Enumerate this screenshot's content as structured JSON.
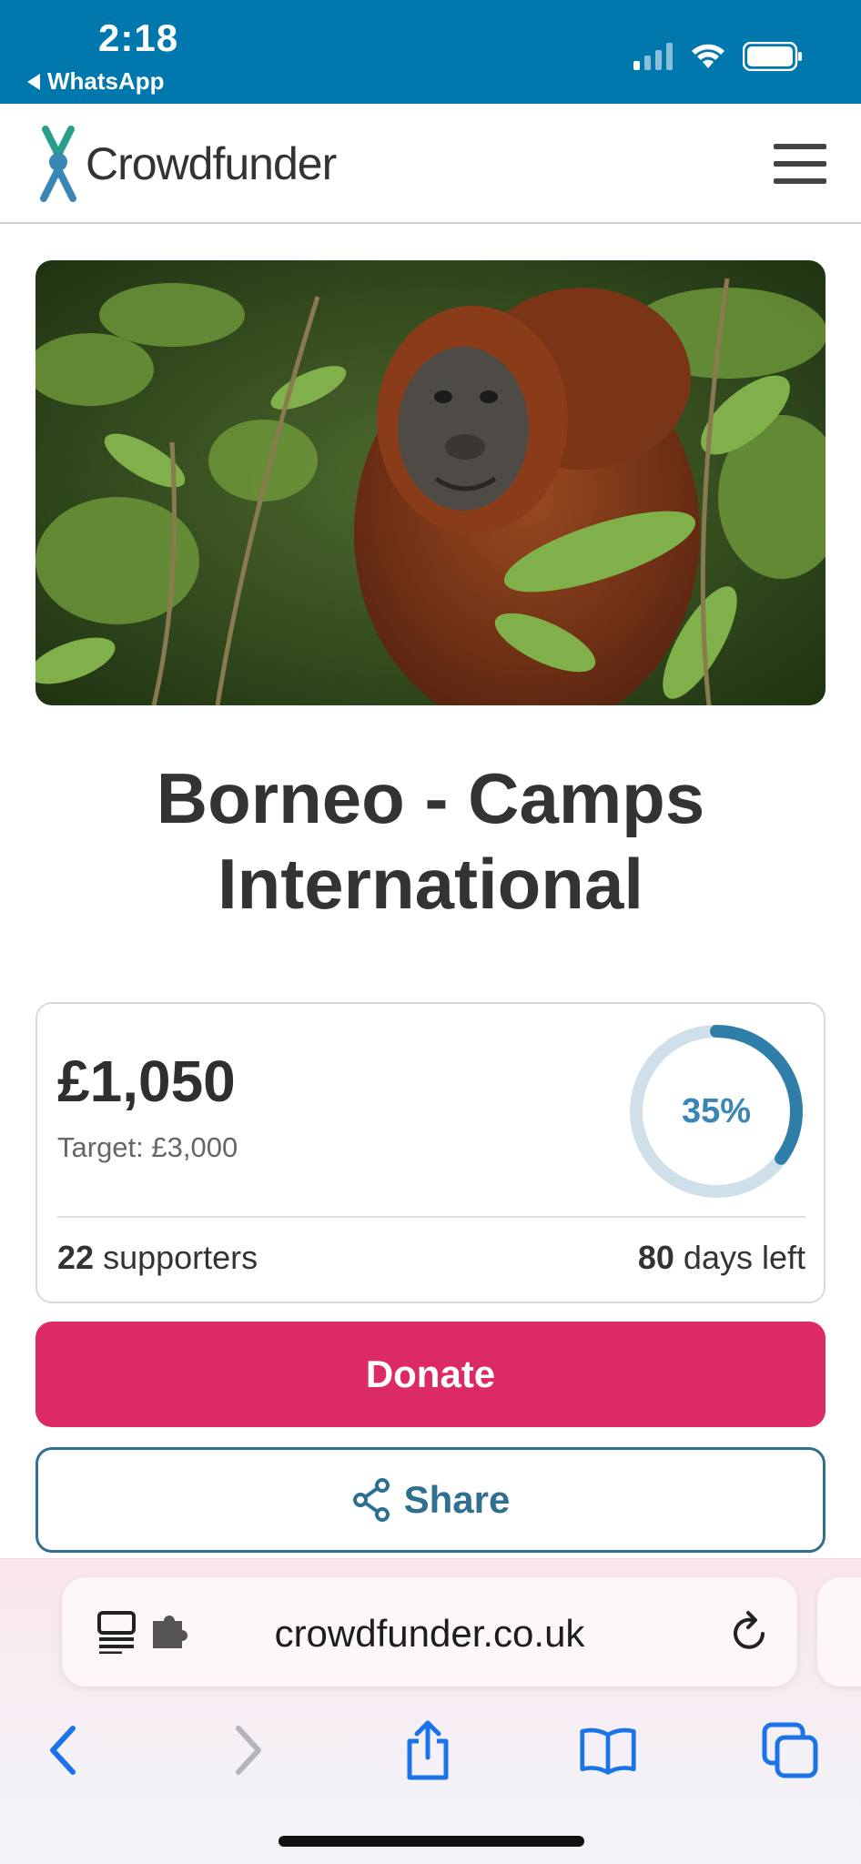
{
  "status_bar": {
    "time": "2:18",
    "back_label": "WhatsApp",
    "background": "#0078ad"
  },
  "header": {
    "logo_text": "Crowdfunder",
    "menu_icon": "hamburger-menu-icon"
  },
  "hero": {
    "icon": "orangutan-photo"
  },
  "campaign": {
    "title": "Borneo - Camps International"
  },
  "stats": {
    "amount_raised": "£1,050",
    "target_label": "Target: £3,000",
    "progress_percent": 35,
    "progress_label": "35%",
    "supporters_count": "22",
    "supporters_label": "supporters",
    "days_count": "80",
    "days_label": "days left"
  },
  "actions": {
    "donate_label": "Donate",
    "share_label": "Share",
    "donate_color": "#dc2a64",
    "share_color": "#2f6f8f"
  },
  "browser": {
    "url": "crowdfunder.co.uk",
    "icons": [
      "reader-icon",
      "extension-icon",
      "reload-icon",
      "back-icon",
      "forward-icon",
      "share-icon",
      "bookmarks-icon",
      "tabs-icon"
    ],
    "accent": "#1a73e8"
  }
}
